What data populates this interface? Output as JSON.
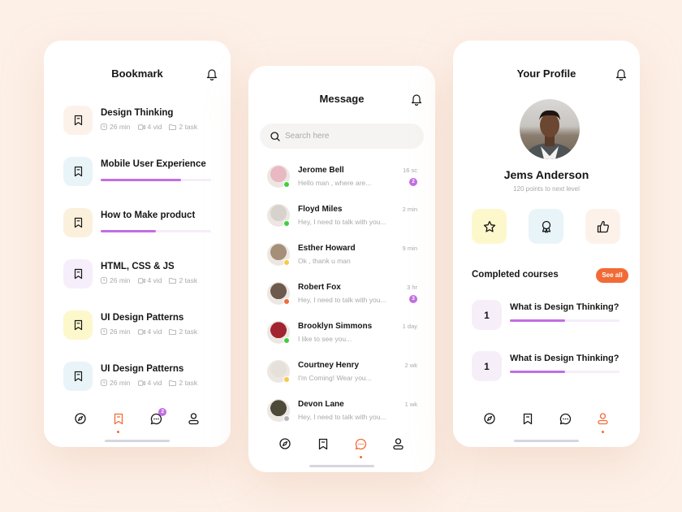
{
  "colors": {
    "background": "#fdf0e7",
    "accent_orange": "#f26b36",
    "accent_purple": "#c16ee2",
    "progress_track": "#f6edfb",
    "online": "#3ecf3e",
    "away": "#f7c948",
    "busy": "#f26b36",
    "offline": "#b5b5b5"
  },
  "bookmark_screen": {
    "title": "Bookmark",
    "bell_icon": "bell-icon",
    "items": [
      {
        "title": "Design Thinking",
        "tile_color": "#fdf2ea",
        "meta": {
          "time": "26 min",
          "videos": "4 vid",
          "tasks": "2 task"
        }
      },
      {
        "title": "Mobile User Experience",
        "tile_color": "#e9f4f8",
        "progress": 0.73
      },
      {
        "title": "How to Make product",
        "tile_color": "#fbf0dc",
        "progress": 0.5
      },
      {
        "title": "HTML, CSS & JS",
        "tile_color": "#f6eefb",
        "meta": {
          "time": "26 min",
          "videos": "4 vid",
          "tasks": "2 task"
        }
      },
      {
        "title": "UI Design Patterns",
        "tile_color": "#fdf7cc",
        "meta": {
          "time": "26 min",
          "videos": "4 vid",
          "tasks": "2 task"
        }
      },
      {
        "title": "UI Design Patterns",
        "tile_color": "#e9f4f8",
        "meta": {
          "time": "26 min",
          "videos": "4 vid",
          "tasks": "2 task"
        }
      }
    ],
    "nav": {
      "active": "bookmark",
      "chat_badge": "2"
    }
  },
  "message_screen": {
    "title": "Message",
    "search": {
      "placeholder": "Search here",
      "value": ""
    },
    "messages": [
      {
        "name": "Jerome Bell",
        "text": "Hello man , where are...",
        "time": "16 sc",
        "badge": "2",
        "status": "online",
        "avatar_color": "#e9b9c3"
      },
      {
        "name": "Floyd Miles",
        "text": "Hey, I need to talk with you...",
        "time": "2 min",
        "badge": null,
        "status": "online",
        "avatar_color": "#d8d2cc"
      },
      {
        "name": "Esther Howard",
        "text": "Ok , thank u man",
        "time": "9 min",
        "badge": null,
        "status": "away",
        "avatar_color": "#a58f78"
      },
      {
        "name": "Robert Fox",
        "text": "Hey, I need to talk with you...",
        "time": "3 hr",
        "badge": "3",
        "status": "busy",
        "avatar_color": "#6e5a4c"
      },
      {
        "name": "Brooklyn Simmons",
        "text": "I like to see you...",
        "time": "1 day",
        "badge": null,
        "status": "online",
        "avatar_color": "#a32431"
      },
      {
        "name": "Courtney Henry",
        "text": "I'm Coming! Wear you...",
        "time": "2 wk",
        "badge": null,
        "status": "away",
        "avatar_color": "#e5e0da"
      },
      {
        "name": "Devon Lane",
        "text": "Hey, I need to talk with you...",
        "time": "1 wk",
        "badge": null,
        "status": "offline",
        "avatar_color": "#4d4a3a"
      }
    ],
    "nav": {
      "active": "chat"
    }
  },
  "profile_screen": {
    "title": "Your Profile",
    "name": "Jems Anderson",
    "subtitle": "120 points to next level",
    "actions": [
      {
        "icon": "star-icon",
        "color": "#fdf7cc"
      },
      {
        "icon": "award-icon",
        "color": "#e9f4f8"
      },
      {
        "icon": "thumbs-up-icon",
        "color": "#fdf2ea"
      }
    ],
    "section_title": "Completed courses",
    "see_all_label": "See all",
    "courses": [
      {
        "number": "1",
        "title": "What is Design Thinking?",
        "progress": 0.5
      },
      {
        "number": "1",
        "title": "What is Design Thinking?",
        "progress": 0.5
      }
    ],
    "nav": {
      "active": "profile"
    }
  }
}
